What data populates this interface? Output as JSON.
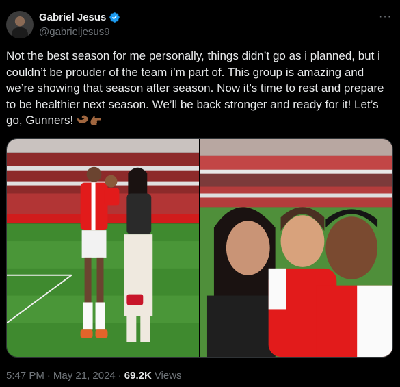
{
  "author": {
    "display_name": "Gabriel Jesus",
    "handle": "@gabrieljesus9",
    "verified": true
  },
  "icons": {
    "more": "more-icon",
    "verified": "verified-badge-icon",
    "emojis": [
      "flexed-biceps-icon",
      "backhand-index-pointing-right-icon"
    ]
  },
  "tweet": {
    "text": "Not the best season for me personally, things didn’t go as i planned, but i couldn’t be prouder of the team i’m part of. This group is amazing and we’re showing that season after season. Now it’s time to rest and prepare to be healthier next season. We’ll be back stronger and ready for it! Let’s go, Gunners! "
  },
  "media": {
    "photo1_alt": "Player in red kit holding child next to woman on pitch",
    "photo2_alt": "Selfie of player, woman and child in stadium"
  },
  "meta": {
    "time": "5:47 PM",
    "sep1": "·",
    "date": "May 21, 2024",
    "sep2": "·",
    "views_count": "69.2K",
    "views_label": "Views"
  },
  "colors": {
    "background": "#000000",
    "text": "#e7e9ea",
    "secondary": "#71767b",
    "verified": "#1d9bf0",
    "arsenal_red": "#db0007"
  }
}
